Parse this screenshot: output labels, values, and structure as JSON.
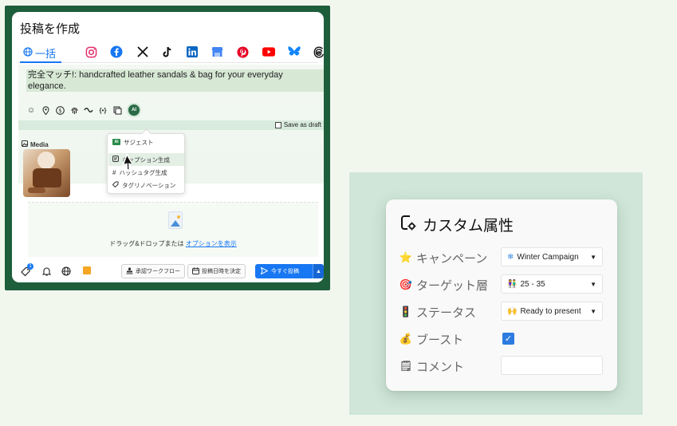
{
  "composer": {
    "title": "投稿を作成",
    "tab_all_label": "一括",
    "networks": [
      "instagram-icon",
      "facebook-icon",
      "x-icon",
      "tiktok-icon",
      "linkedin-icon",
      "google-business-icon",
      "pinterest-icon",
      "youtube-icon",
      "bluesky-icon",
      "threads-icon"
    ],
    "post_text": "完全マッチ!: handcrafted leather sandals & bag for your everyday elegance.",
    "draft_label": "Save as draft",
    "media_label": "Media",
    "dropzone_text": "ドラッグ&ドロップまたは",
    "dropzone_link": "オプションを表示",
    "notification_count": "1",
    "approval_label": "承認ワークフロー",
    "schedule_label": "投稿日時を決定",
    "post_now_label": "今すぐ投稿"
  },
  "ai_menu": {
    "chip": "AI",
    "items": [
      {
        "label": "サジェスト"
      },
      {
        "label": "キャプション生成"
      },
      {
        "label": "ハッシュタグ生成"
      },
      {
        "label": "タグリノベーション"
      }
    ]
  },
  "attributes": {
    "title": "カスタム属性",
    "rows": [
      {
        "label": "キャンペーン",
        "icon": "star-icon",
        "value": "Winter Campaign"
      },
      {
        "label": "ターゲット層",
        "icon": "target-icon",
        "value": "25 - 35"
      },
      {
        "label": "ステータス",
        "icon": "traffic-light-icon",
        "value": "Ready to present"
      },
      {
        "label": "ブースト",
        "icon": "money-bag-icon",
        "checked": true
      },
      {
        "label": "コメント",
        "icon": "notepad-icon",
        "value": ""
      }
    ]
  },
  "colors": {
    "accent": "#1877f2",
    "frame": "#1e5e3a",
    "ai_green": "#2a6b45",
    "checkbox": "#2d7be0"
  }
}
